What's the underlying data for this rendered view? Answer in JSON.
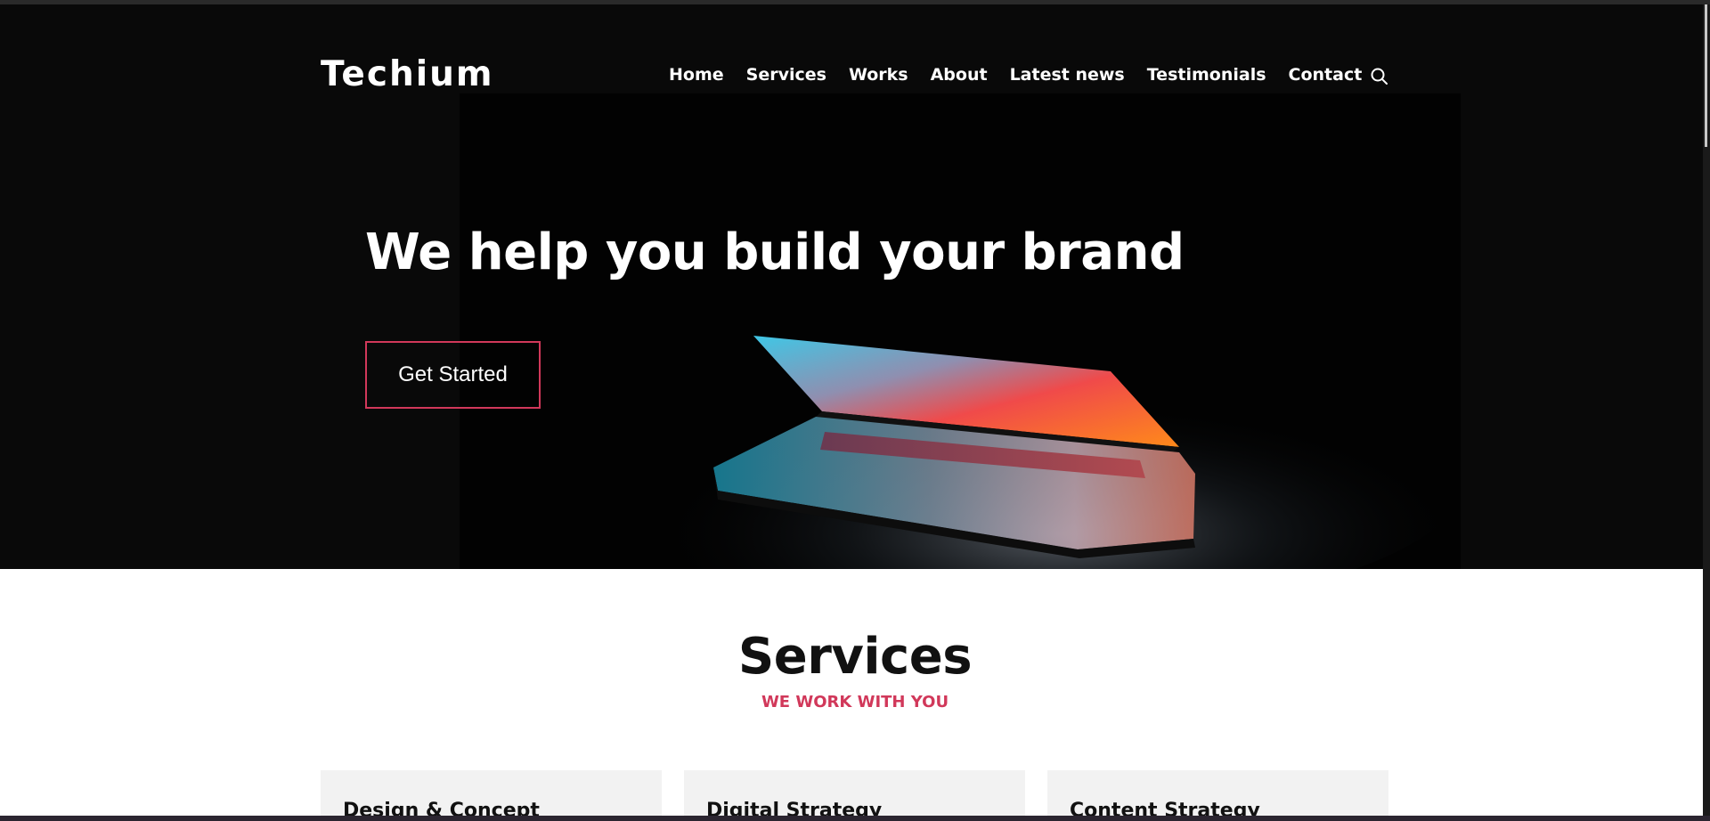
{
  "brand": {
    "name": "Techium"
  },
  "nav": {
    "items": [
      "Home",
      "Services",
      "Works",
      "About",
      "Latest news",
      "Testimonials",
      "Contact"
    ],
    "search_icon": "search-icon"
  },
  "hero": {
    "title": "We help you build your brand",
    "cta_label": "Get Started"
  },
  "services": {
    "title": "Services",
    "subtitle": "WE WORK WITH YOU",
    "cards": [
      {
        "title": "Design & Concept"
      },
      {
        "title": "Digital Strategy"
      },
      {
        "title": "Content Strategy"
      }
    ]
  },
  "colors": {
    "accent": "#d1385a",
    "hero_bg": "#090909",
    "card_bg": "#f2f2f2"
  }
}
